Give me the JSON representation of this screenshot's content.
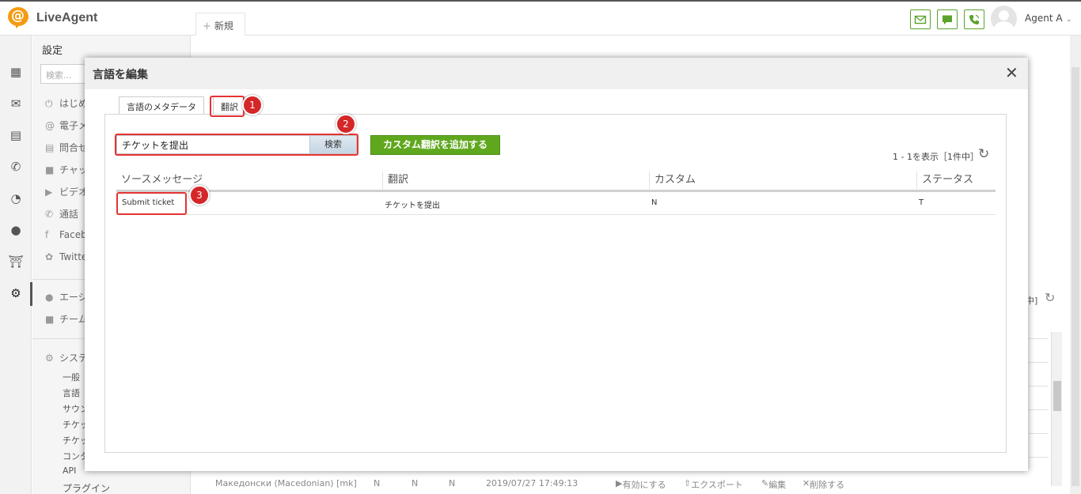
{
  "app": {
    "logo_text": "LiveAgent",
    "new_tab_label": "新規",
    "agent_name": "Agent A"
  },
  "colors": {
    "brand_orange": "#f39c12",
    "accent_green": "#5fa81e",
    "annotation_red": "#d42828"
  },
  "sidebar": {
    "title": "設定",
    "search_placeholder": "検索...",
    "items": [
      {
        "label": "はじめ",
        "icon": "power-icon"
      },
      {
        "label": "電子メ",
        "icon": "at-icon"
      },
      {
        "label": "問合せ",
        "icon": "form-icon"
      },
      {
        "label": "チャッ",
        "icon": "chat-icon"
      },
      {
        "label": "ビデオ",
        "icon": "video-icon"
      },
      {
        "label": "通話",
        "icon": "phone-icon"
      },
      {
        "label": "Faceb",
        "icon": "facebook-icon"
      },
      {
        "label": "Twitte",
        "icon": "twitter-icon"
      },
      {
        "label": "エージ",
        "icon": "agents-icon"
      },
      {
        "label": "チーム",
        "icon": "folder-icon"
      },
      {
        "label": "システ",
        "icon": "gear-icon"
      }
    ],
    "sub_items": [
      "一般",
      "言語",
      "サウン",
      "チケッ",
      "チケッ",
      "コンタ",
      "API",
      "プラグイン"
    ]
  },
  "background": {
    "pager_fragment": "中]",
    "row": {
      "name": "Македонски (Macedonian) [mk]",
      "c1": "N",
      "c2": "N",
      "c3": "N",
      "date": "2019/07/27 17:49:13",
      "action_enable": "有効にする",
      "action_export": "エクスポート",
      "action_edit": "編集",
      "action_delete": "削除する"
    }
  },
  "modal": {
    "title": "言語を編集",
    "tabs": [
      "言語のメタデータ",
      "翻訳"
    ],
    "search_value": "チケットを提出",
    "search_button": "検索",
    "add_button": "カスタム翻訳を追加する",
    "pager": "1 - 1を表示［1件中］",
    "columns": [
      "ソースメッセージ",
      "翻訳",
      "カスタム",
      "ステータス"
    ],
    "rows": [
      {
        "source": "Submit ticket",
        "translation": "チケットを提出",
        "custom": "N",
        "status": "T"
      }
    ]
  },
  "annotations": [
    "1",
    "2",
    "3"
  ]
}
